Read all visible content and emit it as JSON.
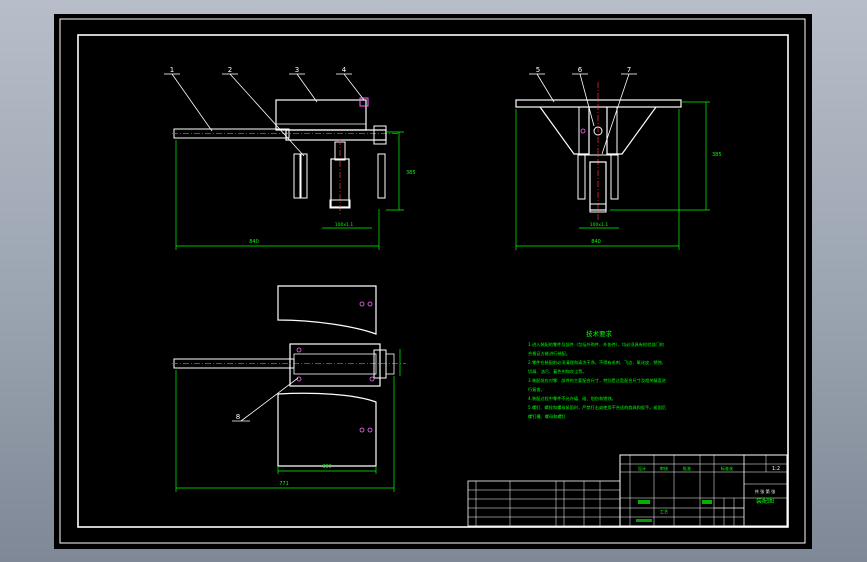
{
  "drawing": {
    "balloons": [
      "1",
      "2",
      "3",
      "4",
      "5",
      "6",
      "7",
      "8"
    ],
    "dimensions": {
      "front_width": "840",
      "front_height": "385",
      "front_sub": "100x1.1",
      "side_width": "840",
      "side_height": "385",
      "side_sub": "100x1.1",
      "top_overall": "771",
      "top_inner": "330"
    }
  },
  "notes": {
    "title": "技术要求",
    "lines": [
      "1.进入装配的零件及部件（包括外购件、外协件），均必须具有检验部门的",
      "合格证方能进行装配。",
      "2.零件在装配前必须清理和清洗干净，不得有毛刺、飞边、氧化皮、锈蚀、",
      "切屑、油污、着色剂和灰尘等。",
      "3.装配前应对零、部件的主要配合尺寸，特别是过盈配合尺寸及相关精度进",
      "行复查。",
      "4.装配过程中零件不允许磕、碰、划伤和锈蚀。",
      "5.螺钉、螺栓和螺母紧固时，严禁打击或使用不合适的旋具和扳手。紧固后",
      "螺钉槽、螺母和螺钉"
    ]
  },
  "title_block": {
    "drawing_name": "装配图",
    "scale": "1:2",
    "sheet": "共 张 第 张",
    "material": "",
    "designer_label": "设计",
    "check_label": "审核",
    "approve_label": "批准",
    "std_label": "标准化",
    "process_label": "工艺"
  },
  "colors": {
    "background": "#000000",
    "frame": "#ffffff",
    "dimension": "#00ff00",
    "centerline": "#ff3030",
    "part": "#ffffff",
    "hidden": "#ff66ff"
  }
}
